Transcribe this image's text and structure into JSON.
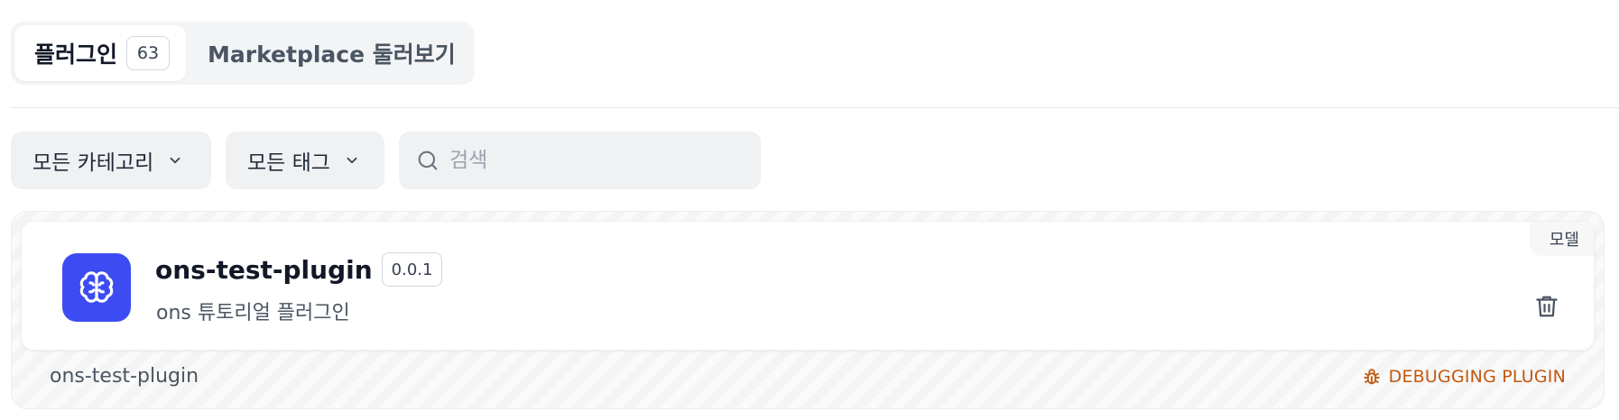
{
  "tabs": [
    {
      "label": "플러그인",
      "count": "63",
      "active": true
    },
    {
      "label": "Marketplace 둘러보기",
      "active": false
    }
  ],
  "filters": {
    "category_label": "모든 카테고리",
    "tag_label": "모든 태그",
    "search_placeholder": "검색",
    "search_value": ""
  },
  "plugin": {
    "name": "ons-test-plugin",
    "version": "0.0.1",
    "description": "ons 튜토리얼 플러그인",
    "category": "모델",
    "id": "ons-test-plugin",
    "status_label": "DEBUGGING PLUGIN",
    "icon": "brain-icon",
    "icon_bg_color": "#3d4cf2",
    "status_color": "#c2580c"
  },
  "icons": {
    "dropdown": "chevron-down-icon",
    "search": "search-icon",
    "delete": "trash-icon",
    "debug": "bug-icon"
  }
}
